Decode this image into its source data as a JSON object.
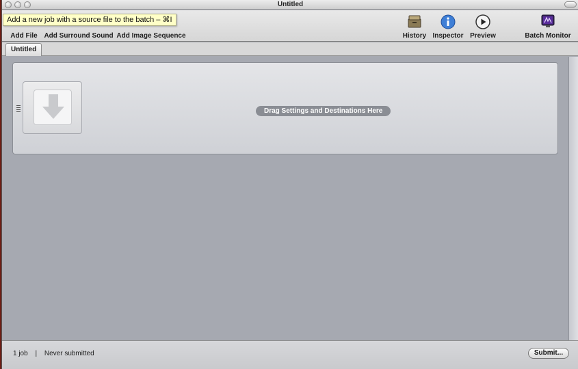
{
  "window": {
    "title": "Untitled"
  },
  "tooltip": {
    "text": "Add a new job with a source file to the batch – ⌘I"
  },
  "toolbar": {
    "add_file": "Add File",
    "add_surround_sound": "Add Surround Sound",
    "add_image_sequence": "Add Image Sequence",
    "history": "History",
    "inspector": "Inspector",
    "preview": "Preview",
    "batch_monitor": "Batch Monitor"
  },
  "tabs": [
    {
      "label": "Untitled"
    }
  ],
  "job": {
    "drop_hint": "Drag Settings and Destinations Here"
  },
  "status": {
    "job_count": "1 job",
    "separator": "|",
    "submission": "Never submitted",
    "submit_label": "Submit..."
  },
  "icons": {
    "history": "archive-box-icon",
    "inspector": "info-icon",
    "preview": "play-icon",
    "batch_monitor": "monitor-icon",
    "drop_target": "download-arrow-icon"
  },
  "colors": {
    "inspector_blue": "#3f7fd6",
    "tooltip_bg": "#ffffc7",
    "batch_monitor_purple": "#5a2d9c"
  }
}
